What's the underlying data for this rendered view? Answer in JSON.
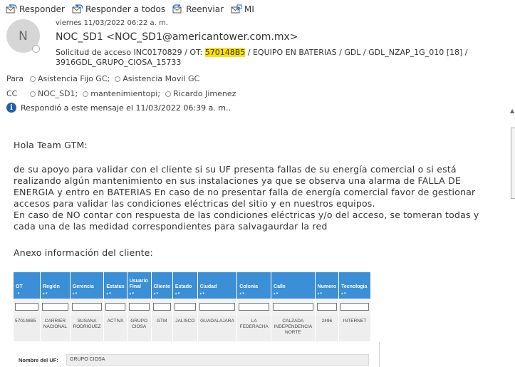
{
  "toolbar": {
    "reply": "Responder",
    "reply_all": "Responder a todos",
    "forward": "Reenviar",
    "im": "MI"
  },
  "header": {
    "avatar_initial": "N",
    "date": "viernes 11/03/2022 06:22 a. m.",
    "from": "NOC_SD1 <NOC_SD1@americantower.com.mx>",
    "subject_prefix": "Solicitud de acceso INC0170829 / OT: ",
    "subject_highlight": "570148B5",
    "subject_suffix": " /  EQUIPO EN BATERIAS / GDL / GDL_NZAP_1G_010 [18] / 3916GDL_GRUPO_CIOSA_15733",
    "to_label": "Para",
    "to": [
      "Asistencia Fijo GC;",
      "Asistencia Movil GC"
    ],
    "cc_label": "CC",
    "cc": [
      "NOC_SD1;",
      "mantenimientopi;",
      "Ricardo Jimenez"
    ],
    "info": "Respondió a este mensaje el 11/03/2022 06:39 a. m.."
  },
  "body": {
    "greeting": "Hola Team GTM:",
    "lines": [
      "de su apoyo para validar con el cliente si su UF presenta fallas de su energía comercial o si está",
      "realizando algún mantenimiento  en sus instalaciones ya que se observa una alarma de FALLA DE",
      "ENERGIA y entro en BATERIAS  En caso de no presentar falla de energía comercial favor de gestionar",
      "accesos para validar las condiciones eléctricas  del sitio y en nuestros  equipos.",
      "En caso de NO contar con respuesta de las condiciones eléctricas y/o del acceso, se tomeran todas y",
      "cada una de las medidad correspondientes  para salvagaurdar la red"
    ],
    "annex": "Anexo información del cliente:"
  },
  "table": {
    "headers": [
      "OT",
      "Región",
      "Gerencia",
      "Estatus",
      "Usuario Final",
      "Cliente",
      "Estado",
      "Ciudad",
      "Colonia",
      "Calle",
      "Numero",
      "Tecnologia"
    ],
    "sort_marks": [
      "- ▾",
      "▴ ▾",
      "▴ ▾",
      "▴ ▾",
      "▴ ▾",
      "▴ ▾",
      "▴ ▾",
      "▴ ▾",
      "▴ ▾",
      "▴ ▾",
      "▴ ▾",
      "▴ ▾"
    ],
    "row": [
      "570148B5",
      "CARRIER NACIONAL",
      "SUSANA RODRIGUEZ",
      "ACTIVA",
      "GRUPO CIOSA",
      "GTM",
      "JALISCO",
      "GUADALAJARA",
      "LA FEDERACHA",
      "CALZADA INDEPENDENCIA NORTE",
      "2496",
      "INTERNET"
    ]
  },
  "uf": {
    "label": "Nombre del UF:",
    "value": "GRUPO CIOSA"
  }
}
